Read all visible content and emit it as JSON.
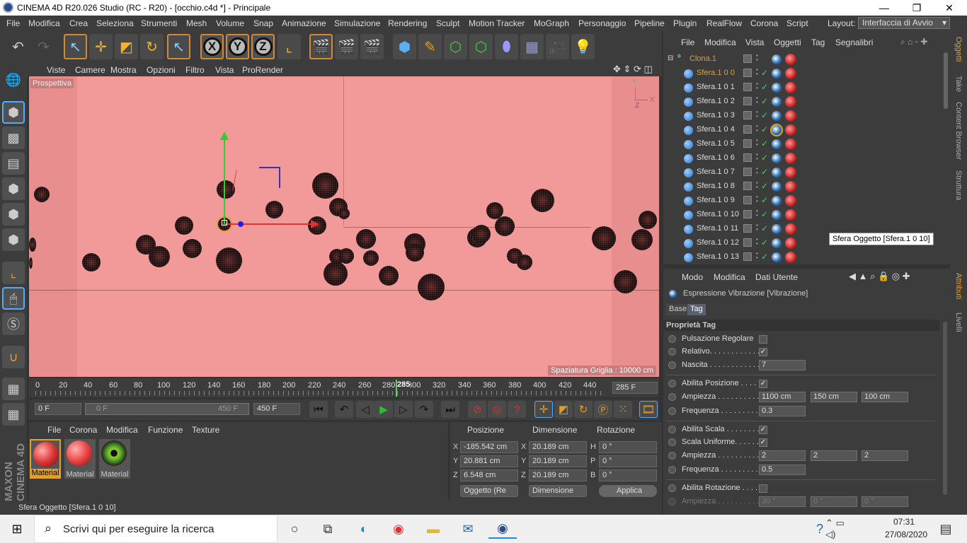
{
  "window": {
    "title": "CINEMA 4D R20.026 Studio (RC - R20) - [occhio.c4d *] - Principale",
    "minimize": "—",
    "maximize": "❐",
    "close": "✕"
  },
  "menubar": {
    "items": [
      "File",
      "Modifica",
      "Crea",
      "Seleziona",
      "Strumenti",
      "Mesh",
      "Volume",
      "Snap",
      "Animazione",
      "Simulazione",
      "Rendering",
      "Sculpt",
      "Motion Tracker",
      "MoGraph",
      "Personaggio",
      "Pipeline",
      "Plugin",
      "RealFlow",
      "Corona",
      "Script"
    ],
    "layout_label": "Layout:",
    "layout_value": "Interfaccia di Avvio"
  },
  "viewport": {
    "menu": [
      "Viste",
      "Camere",
      "Mostra",
      "Opzioni",
      "Filtro",
      "Vista",
      "ProRender"
    ],
    "label": "Prospettiva",
    "grid_spacing": "Spaziatura Griglia : 10000 cm",
    "axis_y": "Y",
    "axis_x": "X",
    "axis_z": "Z",
    "background": "#f29a9a"
  },
  "timeline": {
    "ticks": [
      "0",
      "20",
      "40",
      "60",
      "80",
      "100",
      "120",
      "140",
      "160",
      "180",
      "200",
      "220",
      "240",
      "260",
      "280",
      "300",
      "320",
      "340",
      "360",
      "380",
      "400",
      "420",
      "440"
    ],
    "current_frame_marker": "285",
    "current_frame_field": "285 F"
  },
  "playbar": {
    "start_field": "0 F",
    "range_start": "0 F",
    "range_end": "450 F",
    "end_field": "450 F"
  },
  "materials": {
    "menu": [
      "File",
      "Corona",
      "Modifica",
      "Funzione",
      "Texture"
    ],
    "items": [
      {
        "label": "Material",
        "color": "#d84040"
      },
      {
        "label": "Material",
        "color": "#e05050"
      },
      {
        "label": "Material",
        "color": "eye"
      }
    ]
  },
  "coordinates": {
    "headers": [
      "Posizione",
      "Dimensione",
      "Rotazione"
    ],
    "rows": [
      {
        "axis": "X",
        "pos": "-185.542 cm",
        "dim_axis": "X",
        "dim": "20.189 cm",
        "rot_axis": "H",
        "rot": "0 °"
      },
      {
        "axis": "Y",
        "pos": "20.881 cm",
        "dim_axis": "Y",
        "dim": "20.189 cm",
        "rot_axis": "P",
        "rot": "0 °"
      },
      {
        "axis": "Z",
        "pos": "6.548 cm",
        "dim_axis": "Z",
        "dim": "20.189 cm",
        "rot_axis": "B",
        "rot": "0 °"
      }
    ],
    "mode_select": "Oggetto (Re",
    "dim_select": "Dimensione",
    "apply": "Applica"
  },
  "status": "Sfera Oggetto [Sfera.1 0 10]",
  "object_manager": {
    "menu": [
      "File",
      "Modifica",
      "Vista",
      "Oggetti",
      "Tag",
      "Segnalibri"
    ],
    "parent": "Clona.1",
    "objects": [
      "Sfera.1 0 0",
      "Sfera.1 0 1",
      "Sfera.1 0 2",
      "Sfera.1 0 3",
      "Sfera.1 0 4",
      "Sfera.1 0 5",
      "Sfera.1 0 6",
      "Sfera.1 0 7",
      "Sfera.1 0 8",
      "Sfera.1 0 9",
      "Sfera.1 0 10",
      "Sfera.1 0 11",
      "Sfera.1 0 12",
      "Sfera.1 0 13"
    ],
    "tooltip": "Sfera Oggetto [Sfera.1 0 10]"
  },
  "attributes": {
    "menu": [
      "Modo",
      "Modifica",
      "Dati Utente"
    ],
    "title": "Espressione Vibrazione [Vibrazione]",
    "tabs": [
      "Base",
      "Tag"
    ],
    "section": "Proprietà Tag",
    "pulsazione": "Pulsazione Regolare",
    "relativo": "Relativo. . . . . . . . . . . .",
    "nascita_label": "Nascita . . . . . . . . . . . .",
    "nascita": "7",
    "abilita_posizione": "Abilita Posizione . . . . .",
    "ampiezza_label": "Ampiezza . . . . . . . . . .",
    "ampiezza_pos": [
      "1100 cm",
      "150 cm",
      "100 cm"
    ],
    "frequenza_label": "Frequenza . . . . . . . . .",
    "frequenza_pos": "0.3",
    "abilita_scala": "Abilita Scala . . . . . . . .",
    "scala_uniforme": "Scala Uniforme. . . . . . .",
    "ampiezza_scala": [
      "2",
      "2",
      "2"
    ],
    "frequenza_scala": "0.5",
    "abilita_rotazione": "Abilita Rotazione . . . . .",
    "ampiezza_rot": [
      "30 °",
      "0 °",
      "0 °"
    ]
  },
  "right_strip": [
    "Oggetti",
    "Take",
    "Content Browser",
    "Struttura"
  ],
  "right_strip2": [
    "Attributi",
    "Livelli"
  ],
  "branding": "MAXON CINEMA 4D",
  "taskbar": {
    "search_placeholder": "Scrivi qui per eseguire la ricerca",
    "time": "07:31",
    "date": "27/08/2020"
  }
}
